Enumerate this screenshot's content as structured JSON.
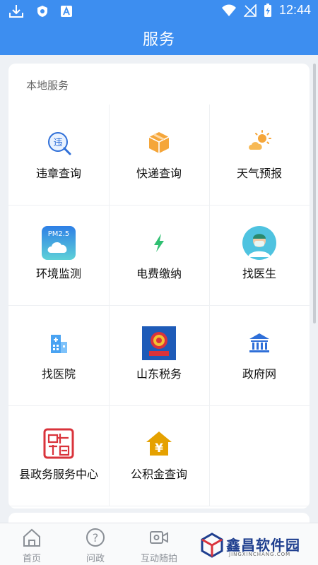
{
  "status_bar": {
    "time": "12:44"
  },
  "app_bar": {
    "title": "服务"
  },
  "local_services": {
    "title": "本地服务",
    "items": [
      {
        "label": "违章查询",
        "icon": "violation-search-icon",
        "badge": "违"
      },
      {
        "label": "快递查询",
        "icon": "package-box-icon"
      },
      {
        "label": "天气预报",
        "icon": "weather-sun-cloud-icon"
      },
      {
        "label": "环境监测",
        "icon": "pm25-cloud-icon",
        "badge": "PM2.5"
      },
      {
        "label": "电费缴纳",
        "icon": "lightning-bolt-icon"
      },
      {
        "label": "找医生",
        "icon": "doctor-avatar-icon"
      },
      {
        "label": "找医院",
        "icon": "hospital-building-icon"
      },
      {
        "label": "山东税务",
        "icon": "tax-emblem-icon"
      },
      {
        "label": "政府网",
        "icon": "government-building-icon"
      },
      {
        "label": "县政务服务中心",
        "icon": "county-seal-icon"
      },
      {
        "label": "公积金查询",
        "icon": "housing-fund-yen-icon",
        "badge": "¥"
      }
    ]
  },
  "bottom_nav": {
    "items": [
      {
        "label": "首页",
        "icon": "home-icon"
      },
      {
        "label": "问政",
        "icon": "question-icon",
        "badge": "?"
      },
      {
        "label": "互动随拍",
        "icon": "camera-video-icon"
      }
    ]
  },
  "watermark": {
    "text": "鑫昌软件园",
    "sub": "JINGXINCHANG.COM"
  },
  "colors": {
    "primary": "#3d8ef0",
    "orange": "#f5a63a",
    "green": "#2fbf71",
    "cyan": "#4fc3e0",
    "red": "#d9333b",
    "gold": "#e5a100"
  }
}
